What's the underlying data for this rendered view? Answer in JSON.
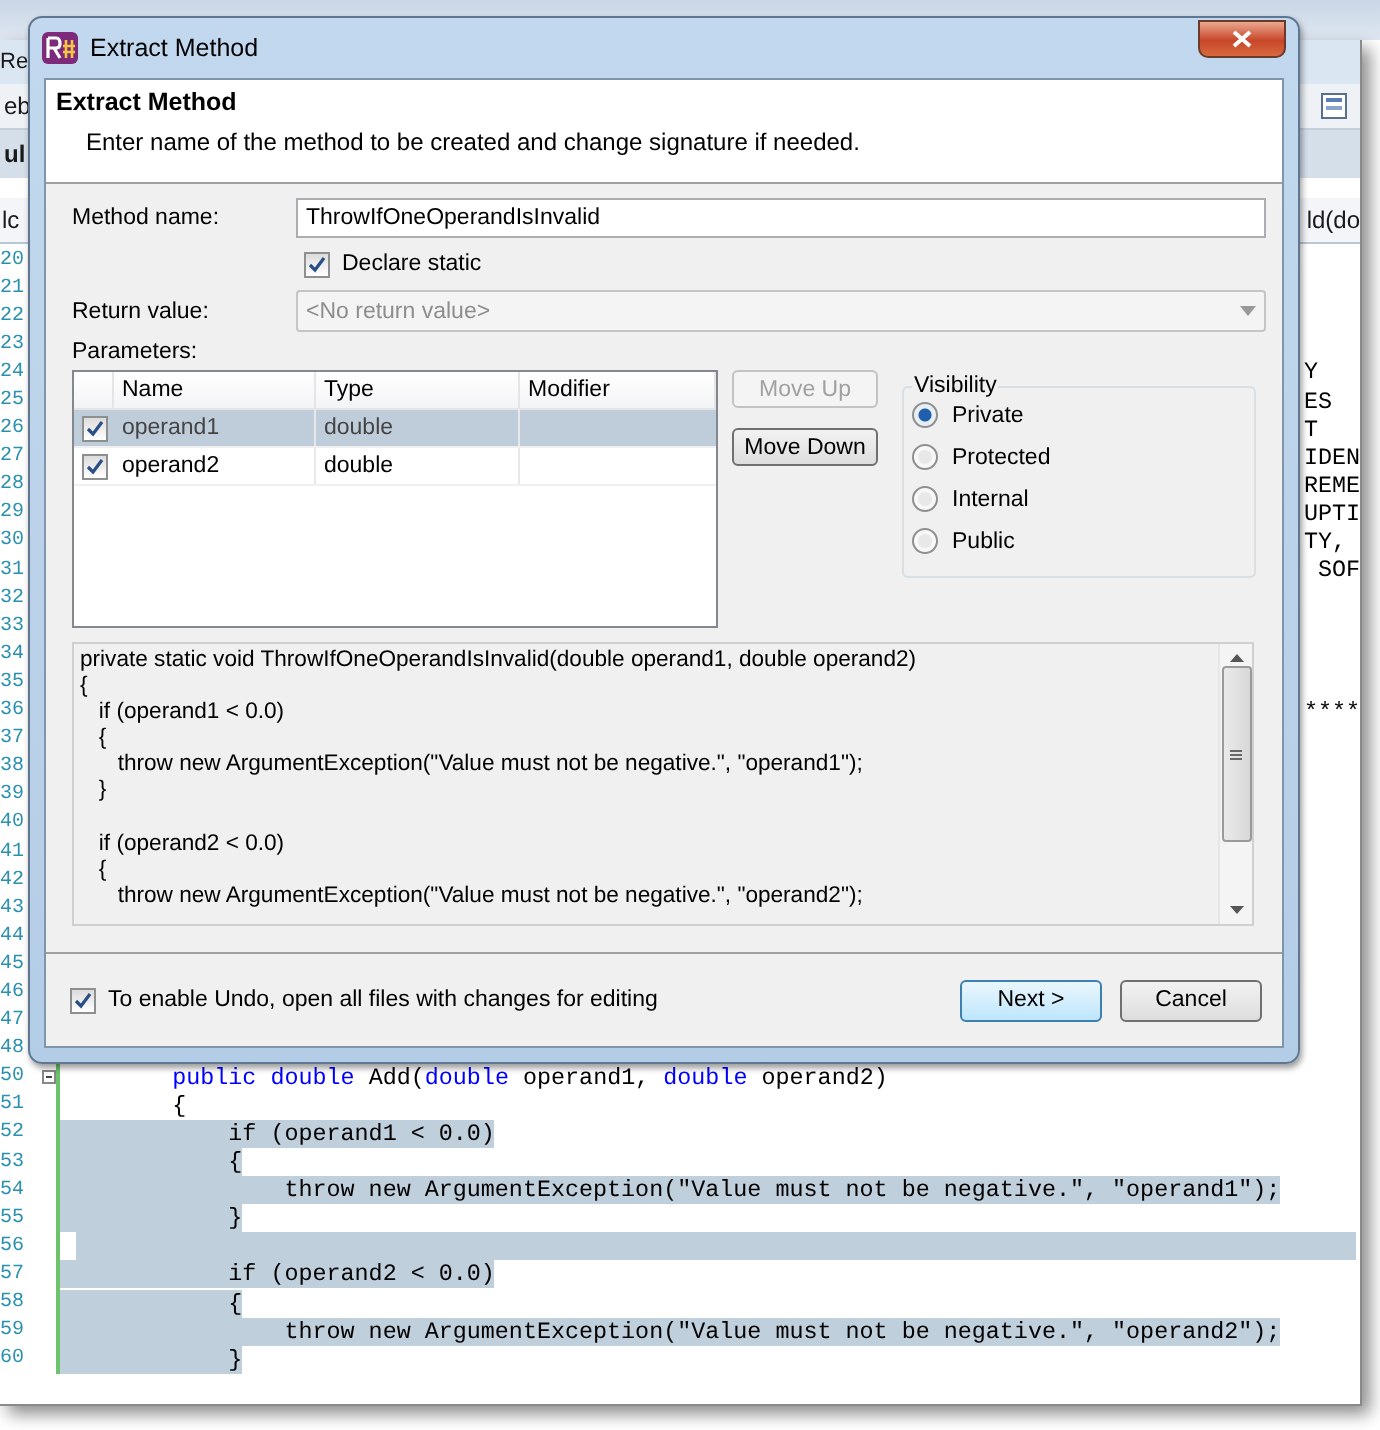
{
  "editor": {
    "title_fragment": "Re",
    "toolbar_fragment": "eb",
    "tab_fragment": "ul",
    "nav_left": "lc",
    "nav_right": "ld(do",
    "lines": [
      {
        "number": "20"
      },
      {
        "number": "21"
      },
      {
        "number": "22"
      },
      {
        "number": "23"
      },
      {
        "number": "24",
        "tail": "Y"
      },
      {
        "number": "25",
        "tail": "ES"
      },
      {
        "number": "26",
        "tail": "T"
      },
      {
        "number": "27",
        "tail": "IDEN"
      },
      {
        "number": "28",
        "tail": "REME"
      },
      {
        "number": "29",
        "tail": "UPTI"
      },
      {
        "number": "30",
        "tail": "TY,"
      },
      {
        "number": "31",
        "tail": " SOF"
      },
      {
        "number": "32"
      },
      {
        "number": "33"
      },
      {
        "number": "34"
      },
      {
        "number": "35"
      },
      {
        "number": "36",
        "tail": "****"
      },
      {
        "number": "37"
      },
      {
        "number": "38"
      },
      {
        "number": "39"
      },
      {
        "number": "40"
      },
      {
        "number": "41"
      },
      {
        "number": "42"
      },
      {
        "number": "43"
      },
      {
        "number": "44"
      },
      {
        "number": "45"
      },
      {
        "number": "46"
      },
      {
        "number": "47"
      },
      {
        "number": "48"
      },
      {
        "number": "50",
        "collapsible": true,
        "selected": false,
        "tokens": [
          {
            "t": "        public",
            "kind": "keyword"
          },
          {
            "t": " double",
            "kind": "keyword"
          },
          {
            "t": " Add(",
            "kind": "plain"
          },
          {
            "t": "double",
            "kind": "keyword"
          },
          {
            "t": " operand1, ",
            "kind": "plain"
          },
          {
            "t": "double",
            "kind": "keyword"
          },
          {
            "t": " operand2)",
            "kind": "plain"
          }
        ]
      },
      {
        "number": "51",
        "selected": false,
        "tokens": [
          {
            "t": "        {",
            "kind": "plain"
          }
        ]
      },
      {
        "number": "52",
        "selected": true,
        "tokens": [
          {
            "t": "            if (operand1 < 0.0)",
            "kind": "plain"
          }
        ]
      },
      {
        "number": "53",
        "selected": true,
        "tokens": [
          {
            "t": "            {",
            "kind": "plain"
          }
        ]
      },
      {
        "number": "54",
        "selected": true,
        "tokens": [
          {
            "t": "                throw new ArgumentException(\"Value must not be negative.\", \"operand1\");",
            "kind": "plain"
          }
        ]
      },
      {
        "number": "55",
        "selected": true,
        "tokens": [
          {
            "t": "            }",
            "kind": "plain"
          }
        ]
      },
      {
        "number": "56",
        "selected": true
      },
      {
        "number": "57",
        "selected": true,
        "tokens": [
          {
            "t": "            if (operand2 < 0.0)",
            "kind": "plain"
          }
        ]
      },
      {
        "number": "58",
        "selected": true,
        "tokens": [
          {
            "t": "            {",
            "kind": "plain"
          }
        ]
      },
      {
        "number": "59",
        "selected": true,
        "tokens": [
          {
            "t": "                throw new ArgumentException(\"Value must not be negative.\", \"operand2\");",
            "kind": "plain"
          }
        ]
      },
      {
        "number": "60",
        "selected": true,
        "tokens": [
          {
            "t": "            }",
            "kind": "plain"
          }
        ]
      }
    ]
  },
  "dialog": {
    "title": "Extract Method",
    "header_title": "Extract Method",
    "header_subtitle": "Enter name of the method to be created and change signature if needed.",
    "method_name": {
      "label": "Method name:",
      "value": "ThrowIfOneOperandIsInvalid"
    },
    "declare_static": {
      "label": "Declare static",
      "checked": true
    },
    "return_value": {
      "label": "Return value:",
      "value": "<No return value>",
      "disabled": true
    },
    "parameters": {
      "label": "Parameters:",
      "columns": [
        "Name",
        "Type",
        "Modifier"
      ],
      "rows": [
        {
          "checked": true,
          "selected": true,
          "name": "operand1",
          "type": "double"
        },
        {
          "checked": true,
          "selected": false,
          "name": "operand2",
          "type": "double"
        }
      ]
    },
    "move_buttons": [
      {
        "label": "Move Up",
        "disabled": true
      },
      {
        "label": "Move Down",
        "disabled": false
      }
    ],
    "visibility": {
      "label": "Visibility",
      "options": [
        {
          "label": "Private",
          "selected": true
        },
        {
          "label": "Protected",
          "selected": false
        },
        {
          "label": "Internal",
          "selected": false
        },
        {
          "label": "Public",
          "selected": false
        }
      ]
    },
    "preview": {
      "blocks": [
        [
          "private static void ThrowIfOneOperandIsInvalid(double operand1, double operand2)",
          "{",
          "   if (operand1 < 0.0)",
          "   {",
          "      throw new ArgumentException(\"Value must not be negative.\", \"operand1\");",
          "   }"
        ],
        [
          "   if (operand2 < 0.0)",
          "   {",
          "      throw new ArgumentException(\"Value must not be negative.\", \"operand2\");"
        ]
      ]
    },
    "undo": {
      "label": "To enable Undo, open all files with changes for editing",
      "checked": true
    },
    "buttons": [
      {
        "label": "Next >",
        "default": true
      },
      {
        "label": "Cancel",
        "default": false
      }
    ]
  }
}
